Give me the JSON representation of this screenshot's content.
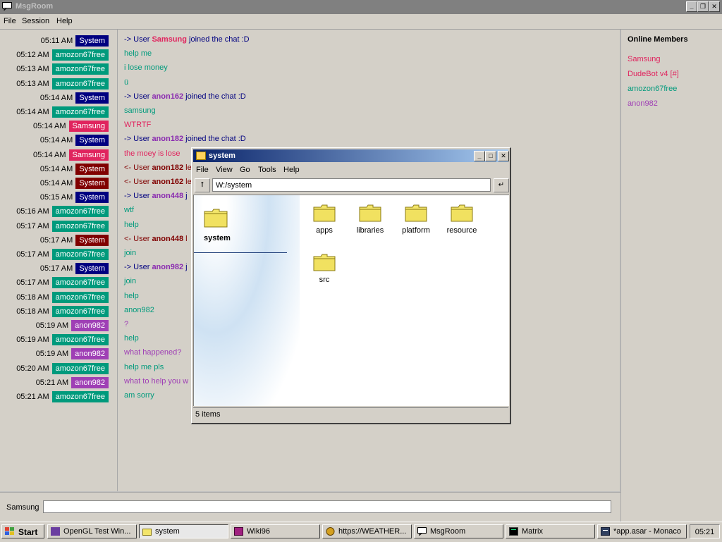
{
  "window": {
    "title": "MsgRoom"
  },
  "menu": [
    "File",
    "Session",
    "Help"
  ],
  "colors": {
    "System": "#000080",
    "SystemLeave": "#800000",
    "amozon67free": "#009a7c",
    "Samsung": "#e0245e",
    "anon982": "#9f3fb5",
    "anon162": "#8a2bb0",
    "anon182": "#8a2bb0",
    "anon448": "#8a2bb0"
  },
  "messages": [
    {
      "time": "05:11 AM",
      "user": "System",
      "text_pre": "-> User ",
      "name": "Samsung",
      "text_post": " joined the chat :D",
      "kind": "join",
      "name_color": "#e0245e"
    },
    {
      "time": "05:12 AM",
      "user": "amozon67free",
      "text": "help me"
    },
    {
      "time": "05:13 AM",
      "user": "amozon67free",
      "text": "i lose money"
    },
    {
      "time": "05:13 AM",
      "user": "amozon67free",
      "text": "ü"
    },
    {
      "time": "05:14 AM",
      "user": "System",
      "text_pre": "-> User ",
      "name": "anon162",
      "text_post": " joined the chat :D",
      "kind": "join",
      "name_color": "#8a2bb0"
    },
    {
      "time": "05:14 AM",
      "user": "amozon67free",
      "text": "samsung"
    },
    {
      "time": "05:14 AM",
      "user": "Samsung",
      "text": "WTRTF"
    },
    {
      "time": "05:14 AM",
      "user": "System",
      "text_pre": "-> User ",
      "name": "anon182",
      "text_post": " joined the chat :D",
      "kind": "join",
      "name_color": "#8a2bb0"
    },
    {
      "time": "05:14 AM",
      "user": "Samsung",
      "text": "the moey is lose"
    },
    {
      "time": "05:14 AM",
      "user": "System",
      "text_pre": "<- User ",
      "name": "anon182",
      "text_post": " le",
      "kind": "leave",
      "name_color": "#800000"
    },
    {
      "time": "05:14 AM",
      "user": "System",
      "text_pre": "<- User ",
      "name": "anon162",
      "text_post": " le",
      "kind": "leave",
      "name_color": "#800000"
    },
    {
      "time": "05:15 AM",
      "user": "System",
      "text_pre": "-> User ",
      "name": "anon448",
      "text_post": " j",
      "kind": "join",
      "name_color": "#8a2bb0"
    },
    {
      "time": "05:16 AM",
      "user": "amozon67free",
      "text": "wtf"
    },
    {
      "time": "05:17 AM",
      "user": "amozon67free",
      "text": "help"
    },
    {
      "time": "05:17 AM",
      "user": "System",
      "text_pre": "<- User ",
      "name": "anon448",
      "text_post": " l",
      "kind": "leave",
      "name_color": "#800000"
    },
    {
      "time": "05:17 AM",
      "user": "amozon67free",
      "text": "join"
    },
    {
      "time": "05:17 AM",
      "user": "System",
      "text_pre": "-> User ",
      "name": "anon982",
      "text_post": " j",
      "kind": "join",
      "name_color": "#8a2bb0"
    },
    {
      "time": "05:17 AM",
      "user": "amozon67free",
      "text": "join"
    },
    {
      "time": "05:18 AM",
      "user": "amozon67free",
      "text": "help"
    },
    {
      "time": "05:18 AM",
      "user": "amozon67free",
      "text": "anon982"
    },
    {
      "time": "05:19 AM",
      "user": "anon982",
      "text": "?"
    },
    {
      "time": "05:19 AM",
      "user": "amozon67free",
      "text": "help"
    },
    {
      "time": "05:19 AM",
      "user": "anon982",
      "text": "what happened?"
    },
    {
      "time": "05:20 AM",
      "user": "amozon67free",
      "text": "help me pls"
    },
    {
      "time": "05:21 AM",
      "user": "anon982",
      "text": "what to help you w"
    },
    {
      "time": "05:21 AM",
      "user": "amozon67free",
      "text": "am sorry"
    }
  ],
  "members": {
    "title": "Online Members",
    "list": [
      {
        "name": "Samsung",
        "color": "#e0245e"
      },
      {
        "name": "DudeBot v4 [#]",
        "color": "#e0245e"
      },
      {
        "name": "amozon67free",
        "color": "#009a7c"
      },
      {
        "name": "anon982",
        "color": "#9f3fb5"
      }
    ]
  },
  "input": {
    "label": "Samsung",
    "value": ""
  },
  "explorer": {
    "title": "system",
    "menu": [
      "File",
      "View",
      "Go",
      "Tools",
      "Help"
    ],
    "address": "W:/system",
    "side_label": "system",
    "items": [
      "apps",
      "libraries",
      "platform",
      "resource",
      "src"
    ],
    "status": "5 items"
  },
  "taskbar": {
    "start": "Start",
    "buttons": [
      "OpenGL Test Win...",
      "system",
      "Wiki96",
      "https://WEATHER...",
      "MsgRoom",
      "Matrix",
      "*app.asar - Monaco"
    ],
    "clock": "05:21"
  }
}
